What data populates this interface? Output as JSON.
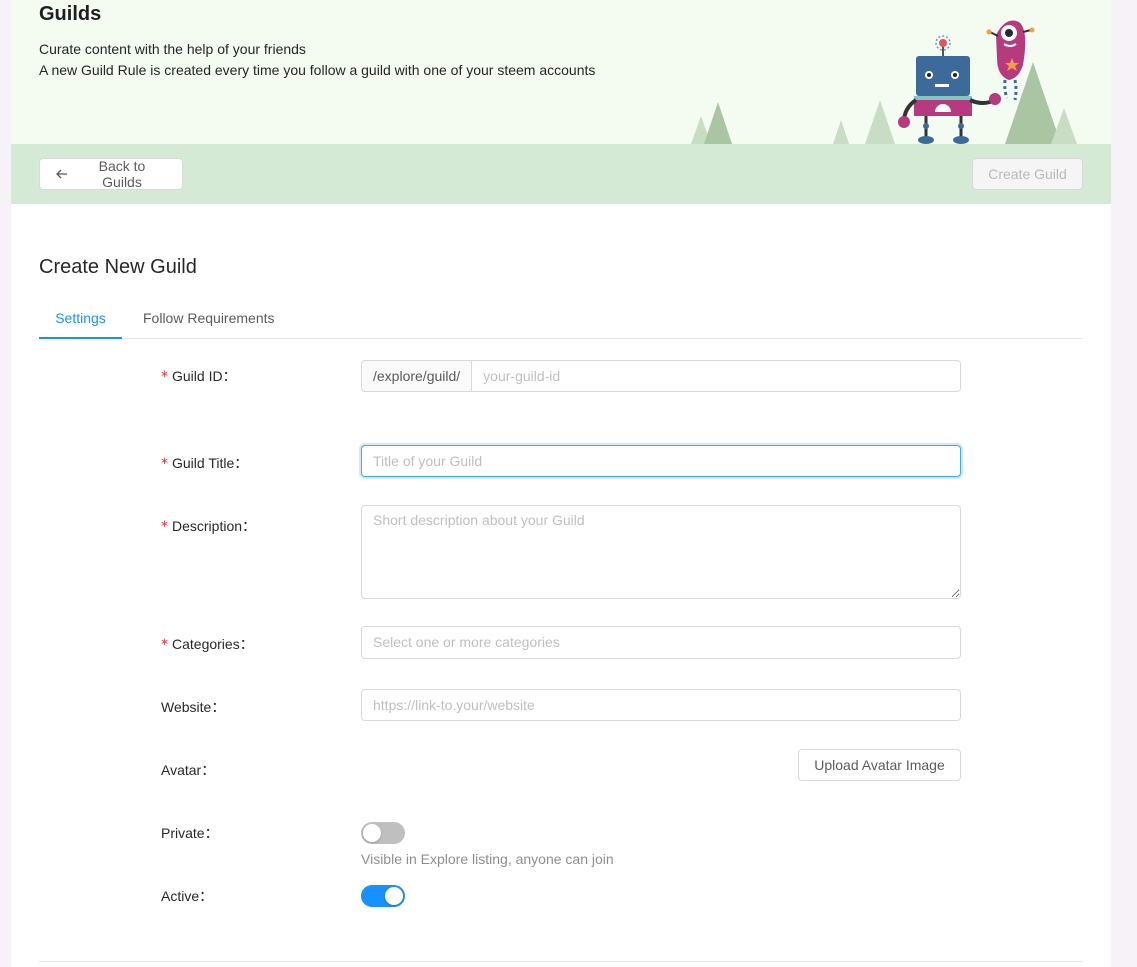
{
  "header": {
    "title": "Guilds",
    "subtitle_line1": "Curate content with the help of your friends",
    "subtitle_line2": "A new Guild Rule is created every time you follow a guild with one of your steem accounts"
  },
  "actions": {
    "back_label": "Back to Guilds",
    "create_label": "Create Guild"
  },
  "form": {
    "title": "Create New Guild",
    "tabs": [
      {
        "label": "Settings",
        "active": true
      },
      {
        "label": "Follow Requirements",
        "active": false
      }
    ],
    "fields": {
      "guild_id": {
        "label": "Guild ID",
        "addon": "/explore/guild/",
        "placeholder": "your-guild-id",
        "value": ""
      },
      "guild_title": {
        "label": "Guild Title",
        "placeholder": "Title of your Guild",
        "value": ""
      },
      "description": {
        "label": "Description",
        "placeholder": "Short description about your Guild",
        "value": ""
      },
      "categories": {
        "label": "Categories",
        "placeholder": "Select one or more categories"
      },
      "website": {
        "label": "Website",
        "placeholder": "https://link-to.your/website",
        "value": ""
      },
      "avatar": {
        "label": "Avatar",
        "button": "Upload Avatar Image"
      },
      "private": {
        "label": "Private",
        "checked": false,
        "help": "Visible in Explore listing, anyone can join"
      },
      "active": {
        "label": "Active",
        "checked": true
      }
    },
    "required_mark": "*",
    "colon": "："
  },
  "colors": {
    "primary": "#1890ff",
    "banner_bg": "#f4fcf2",
    "actionbar_bg": "#d5ead5",
    "required": "#f5222d"
  },
  "icons": {
    "back": "arrow-left-icon"
  }
}
